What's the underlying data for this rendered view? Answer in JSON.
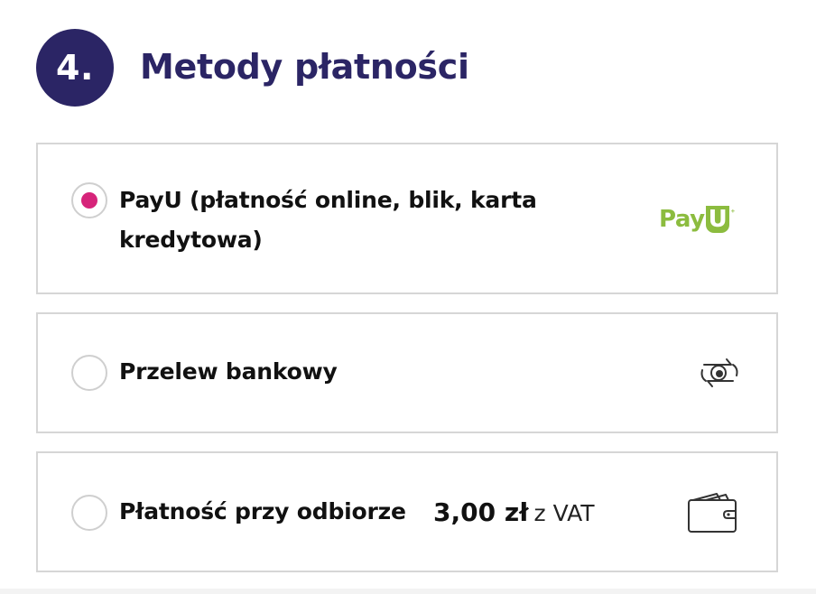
{
  "section": {
    "step_number": "4.",
    "title": "Metody płatności"
  },
  "payment_methods": [
    {
      "id": "payu",
      "label": "PayU (płatność online, blik, karta kredytowa)",
      "selected": true,
      "logo_text_pay": "Pay",
      "logo_text_u": "U",
      "logo_text_dots": "⁺",
      "icon": "payu-logo"
    },
    {
      "id": "bank-transfer",
      "label": "Przelew bankowy",
      "selected": false,
      "icon": "bank-transfer-icon"
    },
    {
      "id": "cash-on-delivery",
      "label": "Płatność przy odbiorze",
      "selected": false,
      "price_amount": "3,00 zł",
      "price_suffix": "z VAT",
      "icon": "wallet-icon"
    }
  ],
  "colors": {
    "brand_navy": "#2b2565",
    "radio_selected": "#d6247a",
    "payu_green": "#8cbc3f",
    "border": "#d6d6d6"
  }
}
